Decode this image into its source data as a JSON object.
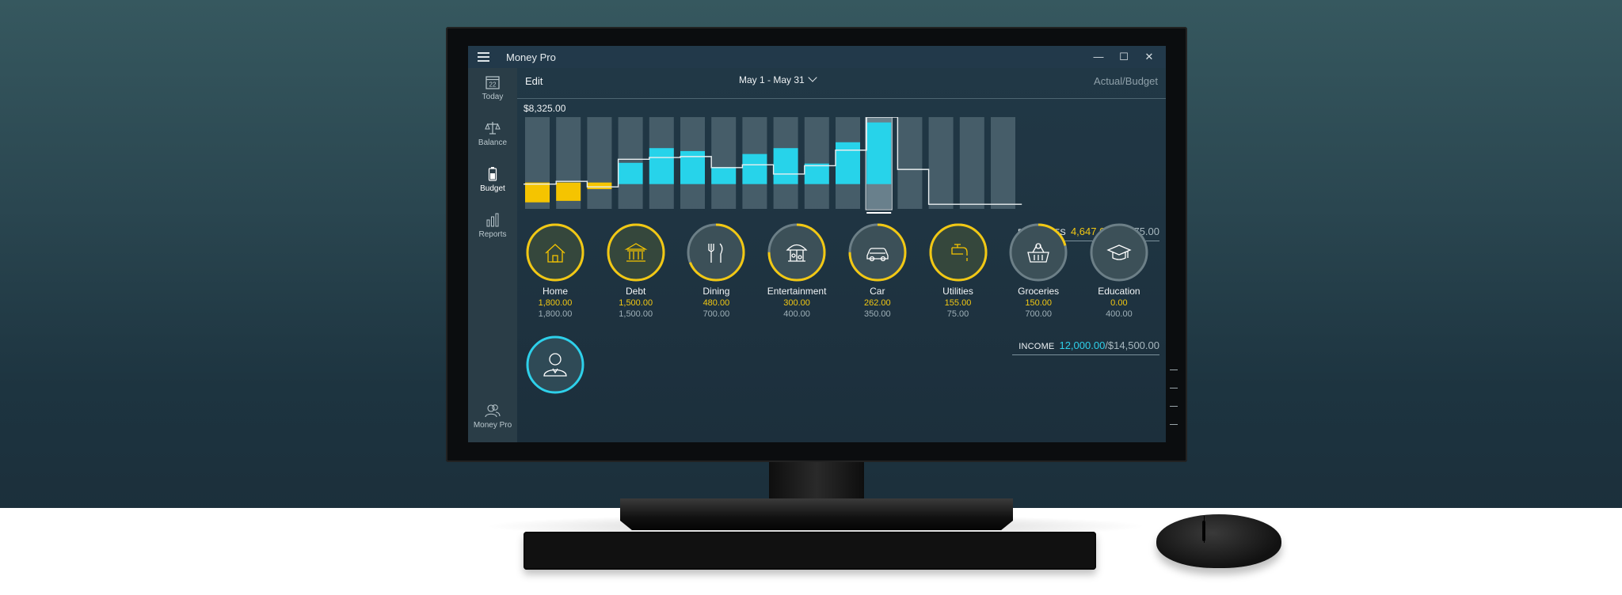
{
  "window": {
    "app_name": "Money Pro",
    "minimize": "—",
    "maximize": "☐",
    "close": "✕"
  },
  "sidebar": {
    "items": [
      {
        "label": "Today",
        "icon": "calendar-icon",
        "day": "22"
      },
      {
        "label": "Balance",
        "icon": "scales-icon"
      },
      {
        "label": "Budget",
        "icon": "battery-icon",
        "active": true
      },
      {
        "label": "Reports",
        "icon": "bar-chart-icon"
      }
    ],
    "account": {
      "label": "Money Pro",
      "icon": "users-icon"
    }
  },
  "header": {
    "edit": "Edit",
    "date_range": "May 1 - May 31",
    "mode": "Actual/Budget"
  },
  "chart_data": {
    "type": "bar",
    "max_label": "$8,325.00",
    "series": [
      {
        "name": "expense",
        "values": [
          0.27,
          0.25,
          0.09,
          0.0,
          0.0,
          0.0,
          0.0,
          0.0,
          0.0,
          0.0,
          0.0,
          0.0,
          0.0,
          0.0,
          0.0,
          0.0
        ]
      },
      {
        "name": "income",
        "values": [
          0.0,
          0.0,
          0.0,
          0.29,
          0.49,
          0.45,
          0.23,
          0.41,
          0.49,
          0.28,
          0.57,
          0.84,
          0.0,
          0.0,
          0.0,
          0.0
        ]
      }
    ],
    "cumulative_line": [
      0.27,
      0.3,
      0.24,
      0.54,
      0.56,
      0.57,
      0.45,
      0.48,
      0.38,
      0.47,
      0.64,
      1.0,
      0.43,
      0.05,
      0.05,
      0.05
    ],
    "zero_level": 0.27,
    "selected_index": 11,
    "colors": {
      "expense": "#f5c400",
      "income": "#27d3ea",
      "track": "#4d6470",
      "line": "#e9eef0"
    }
  },
  "expenses": {
    "label": "EXPENSES",
    "actual": "4,647.00",
    "budget": "/$6,175.00"
  },
  "income": {
    "label": "INCOME",
    "actual": "12,000.00",
    "budget": "/$14,500.00"
  },
  "categories": [
    {
      "name": "Home",
      "spent": "1,800.00",
      "budget": "1,800.00",
      "icon": "house-icon",
      "progress": 1.0,
      "filled": true
    },
    {
      "name": "Debt",
      "spent": "1,500.00",
      "budget": "1,500.00",
      "icon": "bank-icon",
      "progress": 1.0,
      "filled": true
    },
    {
      "name": "Dining",
      "spent": "480.00",
      "budget": "700.00",
      "icon": "fork-knife-icon",
      "progress": 0.69,
      "filled": false
    },
    {
      "name": "Entertainment",
      "spent": "300.00",
      "budget": "400.00",
      "icon": "carousel-icon",
      "progress": 0.75,
      "filled": false
    },
    {
      "name": "Car",
      "spent": "262.00",
      "budget": "350.00",
      "icon": "car-icon",
      "progress": 0.75,
      "filled": false
    },
    {
      "name": "Utilities",
      "spent": "155.00",
      "budget": "75.00",
      "icon": "faucet-icon",
      "progress": 1.0,
      "filled": true
    },
    {
      "name": "Groceries",
      "spent": "150.00",
      "budget": "700.00",
      "icon": "basket-icon",
      "progress": 0.21,
      "filled": false
    },
    {
      "name": "Education",
      "spent": "0.00",
      "budget": "400.00",
      "icon": "graduation-cap-icon",
      "progress": 0.0,
      "filled": false
    }
  ],
  "income_categories": [
    {
      "icon": "person-icon",
      "progress": 1.0
    }
  ]
}
